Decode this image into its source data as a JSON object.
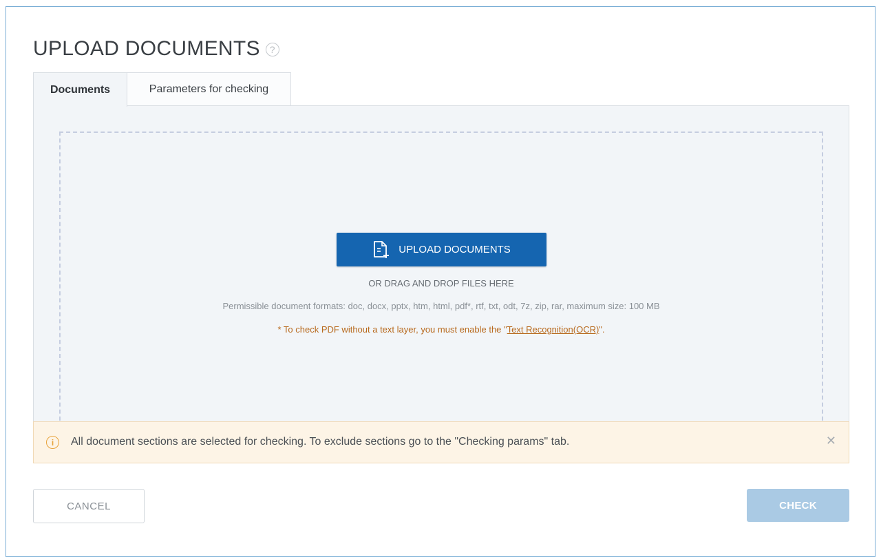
{
  "page": {
    "title": "UPLOAD DOCUMENTS",
    "help_icon": "question-circle-icon"
  },
  "tabs": [
    {
      "label": "Documents",
      "active": true
    },
    {
      "label": "Parameters for checking",
      "active": false
    }
  ],
  "upload": {
    "button_label": "UPLOAD DOCUMENTS",
    "button_icon": "file-add-icon",
    "drag_text": "OR DRAG AND DROP FILES HERE",
    "formats_text": "Permissible document formats: doc, docx, pptx, htm, html, pdf*, rtf, txt, odt, 7z, zip, rar, maximum size: 100 MB",
    "ocr_note_prefix": "* To check PDF without a text layer, you must enable the \"",
    "ocr_link": "Text Recognition(OCR)",
    "ocr_note_suffix": "\"."
  },
  "notice": {
    "icon": "info-circle-icon",
    "text": "All document sections are selected for checking. To exclude sections go to the \"Checking params\" tab.",
    "close_icon": "close-icon"
  },
  "footer": {
    "cancel_label": "CANCEL",
    "check_label": "CHECK"
  },
  "colors": {
    "primary": "#1565b0",
    "check_disabled": "#aacae4",
    "notice_bg": "#fdf4e6",
    "warning": "#e8a33a",
    "ocr_note": "#b86a1e"
  }
}
